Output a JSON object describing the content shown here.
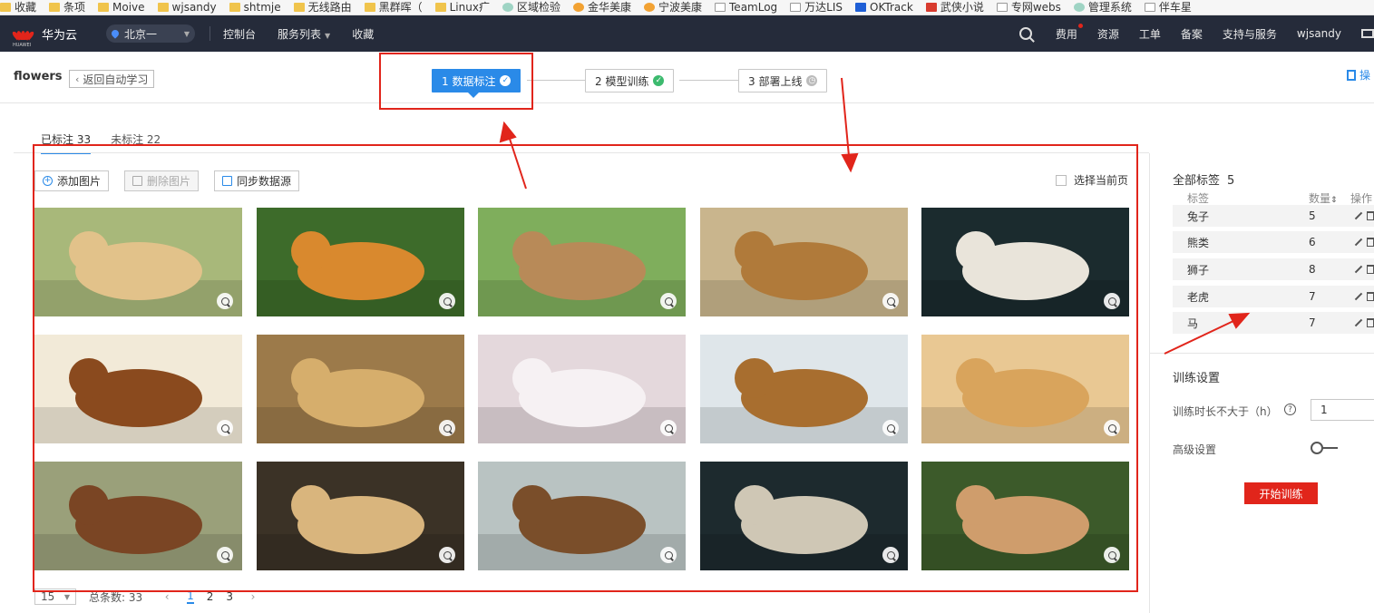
{
  "bookmarks": [
    "收藏",
    "条项",
    "Moive",
    "wjsandy",
    "shtmje",
    "无线路由",
    "黑群晖（",
    "Linux疒",
    "区域检验",
    "金华美康",
    "宁波美康",
    "TeamLog",
    "万达LIS",
    "OKTrack",
    "武侠小说",
    "专网webs",
    "管理系统",
    "伴车星"
  ],
  "topnav": {
    "logo_small": "HUAWEI",
    "brand": "华为云",
    "region": "北京一",
    "links": [
      "控制台",
      "服务列表",
      "收藏"
    ],
    "right_links": [
      "费用",
      "资源",
      "工单",
      "备案",
      "支持与服务",
      "wjsandy"
    ]
  },
  "header": {
    "project": "flowers",
    "back_label": "返回自动学习",
    "steps": [
      {
        "label": "1 数据标注"
      },
      {
        "label": "2 模型训练"
      },
      {
        "label": "3 部署上线"
      }
    ],
    "ops_label": "操"
  },
  "tabs": [
    {
      "label": "已标注 33"
    },
    {
      "label": "未标注 22"
    }
  ],
  "toolbar": {
    "add": "添加图片",
    "delete": "删除图片",
    "sync": "同步数据源",
    "select_page": "选择当前页"
  },
  "images": [
    {
      "subject": "rabbit",
      "bg": "#a8b87a",
      "fg": "#e2c28a"
    },
    {
      "subject": "tiger",
      "bg": "#3d6b2a",
      "fg": "#d9892e"
    },
    {
      "subject": "horse",
      "bg": "#7fae5c",
      "fg": "#b88a58"
    },
    {
      "subject": "lion",
      "bg": "#c9b58d",
      "fg": "#b07a3a"
    },
    {
      "subject": "rabbit",
      "bg": "#1b2b2e",
      "fg": "#e9e4da"
    },
    {
      "subject": "horse",
      "bg": "#f2ead8",
      "fg": "#8a4a1e"
    },
    {
      "subject": "lion",
      "bg": "#9c7a4a",
      "fg": "#d6ae6c"
    },
    {
      "subject": "rabbit",
      "bg": "#e4d8dc",
      "fg": "#f6f1f3"
    },
    {
      "subject": "lion",
      "bg": "#dfe6ea",
      "fg": "#a86e2f"
    },
    {
      "subject": "rabbit",
      "bg": "#e9c893",
      "fg": "#d9a45c"
    },
    {
      "subject": "horse",
      "bg": "#9aa07a",
      "fg": "#7a4524"
    },
    {
      "subject": "lion",
      "bg": "#3b3226",
      "fg": "#d9b57d"
    },
    {
      "subject": "bear",
      "bg": "#b9c3c2",
      "fg": "#7a4e2a"
    },
    {
      "subject": "horse",
      "bg": "#1d2a2e",
      "fg": "#cfc7b5"
    },
    {
      "subject": "rabbit",
      "bg": "#3c5a2a",
      "fg": "#cf9d6c"
    }
  ],
  "pager": {
    "size": "15",
    "total": "总条数: 33",
    "pages": [
      "1",
      "2",
      "3"
    ]
  },
  "labels": {
    "title": "全部标签",
    "count": "5",
    "col_label": "标签",
    "col_count": "数量",
    "col_ops": "操作",
    "rows": [
      {
        "name": "兔子",
        "count": "5"
      },
      {
        "name": "熊类",
        "count": "6"
      },
      {
        "name": "狮子",
        "count": "8"
      },
      {
        "name": "老虎",
        "count": "7"
      },
      {
        "name": "马",
        "count": "7"
      }
    ]
  },
  "training": {
    "title": "训练设置",
    "max_hours_label": "训练时长不大于（h）",
    "max_hours_value": "1",
    "advanced_label": "高级设置",
    "advanced_enabled": false,
    "start_label": "开始训练"
  },
  "colors": {
    "nav_bg": "#252b3a",
    "accent": "#2a8ae8",
    "annotation": "#e1251b",
    "start_button": "#e1251b"
  }
}
